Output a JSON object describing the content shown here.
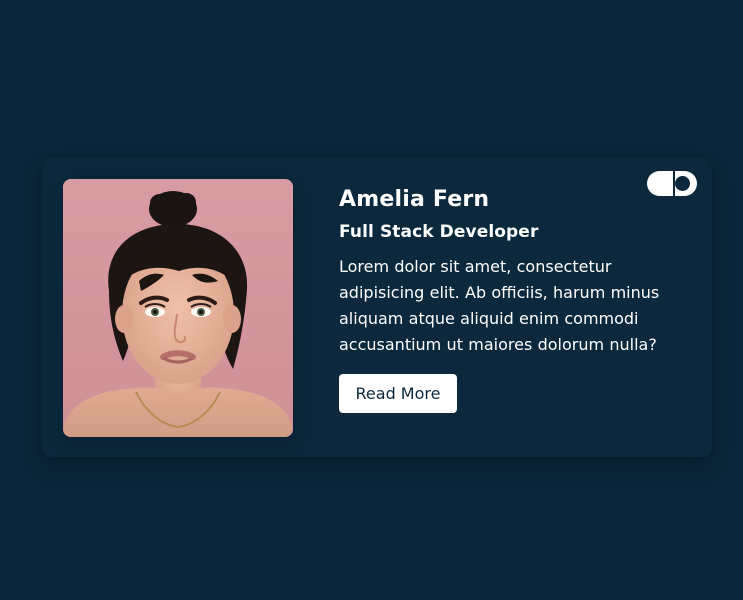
{
  "profile": {
    "name": "Amelia Fern",
    "title": "Full Stack Developer",
    "bio": "Lorem dolor sit amet, consectetur adipisicing elit. Ab officiis, harum minus aliquam atque aliquid enim commodi accusantium ut maiores dolorum nulla?",
    "read_more_label": "Read More"
  },
  "toggle": {
    "state": "on"
  },
  "colors": {
    "page_background": "#0a263a",
    "card_background": "#0b283c",
    "photo_background": "#d79aa0",
    "text": "#ffffff",
    "button_text": "#0b283c"
  }
}
